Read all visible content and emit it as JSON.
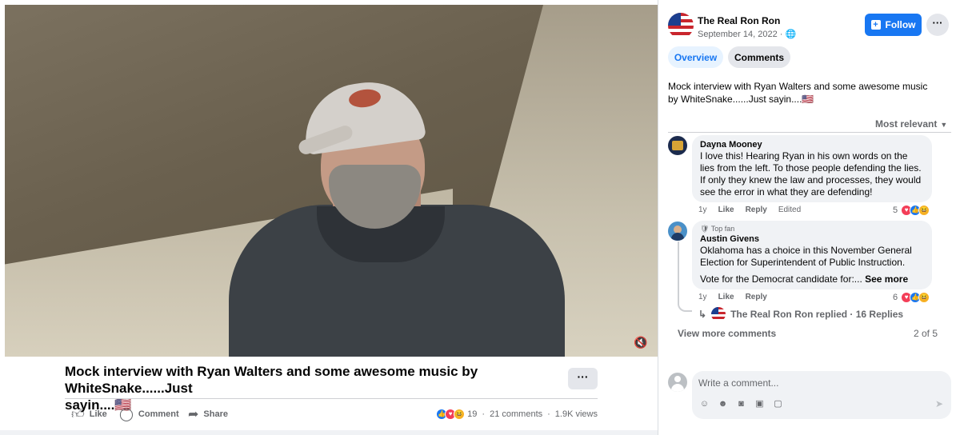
{
  "post": {
    "title_line1": "Mock interview with Ryan Walters and some awesome music by WhiteSnake......Just",
    "title_line2": "sayin....🇺🇸",
    "title_more": "···",
    "actions": {
      "like": "Like",
      "comment": "Comment",
      "share": "Share"
    },
    "reaction_count": "19",
    "comments_count": "21 comments",
    "views": "1.9K views"
  },
  "video": {
    "mute_icon": "speaker-muted-icon"
  },
  "panel": {
    "page_name": "The Real Ron Ron",
    "date": "September 14, 2022 · 🌐",
    "follow_label": "Follow",
    "more_label": "···",
    "tabs": [
      {
        "label": "Overview"
      },
      {
        "label": "Comments"
      }
    ],
    "description": "Mock interview with Ryan Walters and some awesome music by WhiteSnake......Just sayin....🇺🇸",
    "sort_label": "Most relevant"
  },
  "comments": [
    {
      "name": "Dayna Mooney",
      "text": "I love this! Hearing Ryan in his own words on the lies from the left. To those people defending the lies. If only they knew the law and processes, they would see the error in what they are defending!",
      "age": "1y",
      "like": "Like",
      "reply": "Reply",
      "edited": "Edited",
      "reactions": "5"
    },
    {
      "badge": "🛡 Top fan",
      "name": "Austin Givens",
      "text": "Oklahoma has a choice in this November General Election for Superintendent of Public Instruction.",
      "text2": "Vote for the Democrat candidate for:...",
      "see_more": "See more",
      "age": "1y",
      "like": "Like",
      "reply": "Reply",
      "reactions": "6"
    }
  ],
  "replies_line": "The Real Ron Ron replied · 16 Replies",
  "view_more": "View more comments",
  "pager": "2 of 5",
  "composer": {
    "placeholder": "Write a comment..."
  },
  "colors": {
    "accent": "#1877f2",
    "background": "#f0f2f5",
    "secondary_text": "#65676b"
  }
}
